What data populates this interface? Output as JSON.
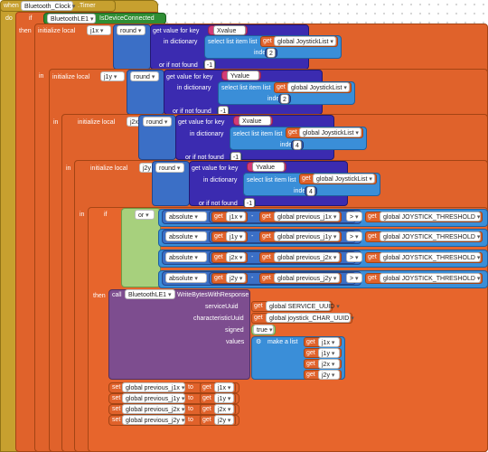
{
  "event": {
    "when": "when",
    "component": "Bluetooth_Clock",
    "event": ".Timer",
    "do": "do"
  },
  "if_block": {
    "if": "if",
    "then": "then",
    "in": "in",
    "component": "BluetoothLE1",
    "method": "IsDeviceConnected"
  },
  "locals": [
    {
      "label": "initialize local",
      "name": "j1x",
      "to": "to",
      "round": "round",
      "get_value": "get value for key",
      "key": "Xvalue",
      "in_dict": "in dictionary",
      "select": "select list item list",
      "list": "global JoystickList",
      "index_label": "index",
      "index": "2",
      "not_found": "or if not found",
      "default": "-1"
    },
    {
      "label": "initialize local",
      "name": "j1y",
      "to": "to",
      "round": "round",
      "get_value": "get value for key",
      "key": "Yvalue",
      "in_dict": "in dictionary",
      "select": "select list item list",
      "list": "global JoystickList",
      "index_label": "index",
      "index": "2",
      "not_found": "or if not found",
      "default": "-1"
    },
    {
      "label": "initialize local",
      "name": "j2x",
      "to": "to",
      "round": "round",
      "get_value": "get value for key",
      "key": "Xvalue",
      "in_dict": "in dictionary",
      "select": "select list item list",
      "list": "global JoystickList",
      "index_label": "index",
      "index": "4",
      "not_found": "or if not found",
      "default": "-1"
    },
    {
      "label": "initialize local",
      "name": "j2y",
      "to": "to",
      "round": "round",
      "get_value": "get value for key",
      "key": "Yvalue",
      "in_dict": "in dictionary",
      "select": "select list item list",
      "list": "global JoystickList",
      "index_label": "index",
      "index": "4",
      "not_found": "or if not found",
      "default": "-1"
    }
  ],
  "condition": {
    "or": "or",
    "rows": [
      {
        "abs": "absolute",
        "get": "get",
        "var": "j1x",
        "minus": "-",
        "prev": "global previous_j1x",
        "gt": ">",
        "threshold": "global JOYSTICK_THRESHOLD"
      },
      {
        "abs": "absolute",
        "get": "get",
        "var": "j1y",
        "minus": "-",
        "prev": "global previous_j1y",
        "gt": ">",
        "threshold": "global JOYSTICK_THRESHOLD"
      },
      {
        "abs": "absolute",
        "get": "get",
        "var": "j2x",
        "minus": "-",
        "prev": "global previous_j2x",
        "gt": ">",
        "threshold": "global JOYSTICK_THRESHOLD"
      },
      {
        "abs": "absolute",
        "get": "get",
        "var": "j2y",
        "minus": "-",
        "prev": "global previous_j2y",
        "gt": ">",
        "threshold": "global JOYSTICK_THRESHOLD"
      }
    ]
  },
  "call": {
    "call": "call",
    "component": "BluetoothLE1",
    "method": "WriteBytesWithResponse",
    "service_label": "serviceUuid",
    "service": "global SERVICE_UUID",
    "char_label": "characteristicUuid",
    "char": "global joystick_CHAR_UUID",
    "signed_label": "signed",
    "signed": "true",
    "values_label": "values",
    "make_list": "make a list",
    "items": [
      "j1x",
      "j1y",
      "j2x",
      "j2y"
    ]
  },
  "sets": [
    {
      "set": "set",
      "target": "global previous_j1x",
      "to": "to",
      "src": "j1x"
    },
    {
      "set": "set",
      "target": "global previous_j1y",
      "to": "to",
      "src": "j1y"
    },
    {
      "set": "set",
      "target": "global previous_j2x",
      "to": "to",
      "src": "j2x"
    },
    {
      "set": "set",
      "target": "global previous_j2y",
      "to": "to",
      "src": "j2y"
    }
  ],
  "get_label": "get"
}
